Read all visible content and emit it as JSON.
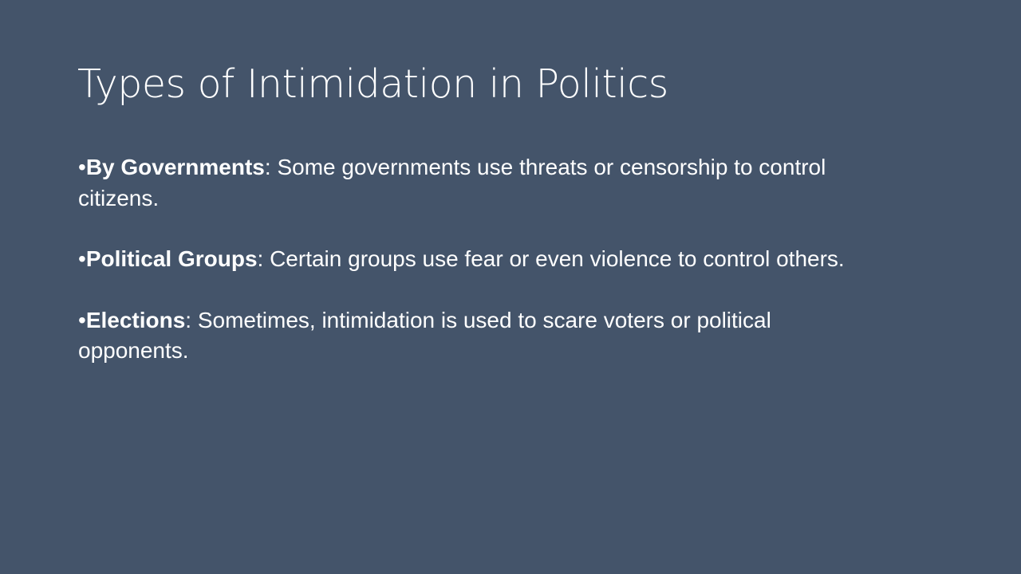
{
  "slide": {
    "title": "Types of Intimidation in Politics",
    "bullets": [
      {
        "marker": "•",
        "term": "By Governments",
        "separator": ":",
        "text": " Some governments use threats or censorship to control citizens."
      },
      {
        "marker": "•",
        "term": "Political Groups",
        "separator": ":",
        "text": " Certain groups use fear or even violence to control others."
      },
      {
        "marker": "•",
        "term": "Elections",
        "separator": ":",
        "text": " Sometimes, intimidation is used to scare voters or political opponents."
      }
    ]
  },
  "colors": {
    "background": "#44546a",
    "text": "#ffffff"
  }
}
